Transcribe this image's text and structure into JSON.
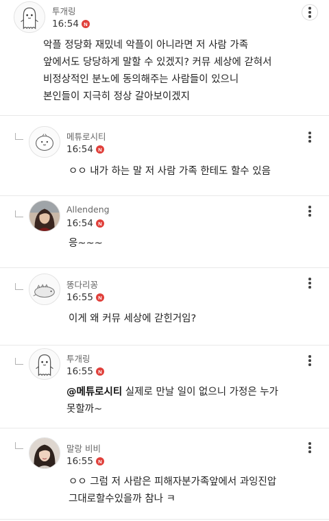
{
  "comments": [
    {
      "nickname": "투개링",
      "time": "16:54",
      "badge": "N",
      "avatar_icon": "ghost-character-icon",
      "text": "악플 정당화 재밌네 악플이 아니라면 저 사람 가족\n앞에서도 당당하게 말할 수 있겠지? 커뮤 세상에 갇혀서\n비정상적인 분노에 동의해주는 사람들이 있으니\n본인들이 지극히 정상 갈아보이겠지"
    },
    {
      "nickname": "메튜로시티",
      "time": "16:54",
      "badge": "N",
      "avatar_icon": "round-blob-character-icon",
      "text": "ㅇㅇ 내가 하는 말 저 사람 가족 한테도 할수 있음"
    },
    {
      "nickname": "Allendeng",
      "time": "16:54",
      "badge": "N",
      "avatar_icon": "profile-photo-woman",
      "text": "응~~~"
    },
    {
      "nickname": "똥다리꽁",
      "time": "16:55",
      "badge": "N",
      "avatar_icon": "lying-creature-icon",
      "text": "이게 왜 커뮤 세상에 갇힌거임?"
    },
    {
      "nickname": "투개링",
      "time": "16:55",
      "badge": "N",
      "avatar_icon": "ghost-character-icon",
      "mention": "@메튜로시티",
      "text": " 실제로 만날 일이 없으니 가정은 누가\n못할까~"
    },
    {
      "nickname": "말랑 비비",
      "time": "16:55",
      "badge": "N",
      "avatar_icon": "profile-photo-woman",
      "text": "ㅇㅇ 그럼 저 사람은 피해자분가족앞에서 과잉진압\n그대로할수있을까 참나 ㅋ"
    }
  ],
  "colors": {
    "badge": "#e0403b",
    "divider": "#e8e8e8",
    "nickname": "#666666"
  }
}
